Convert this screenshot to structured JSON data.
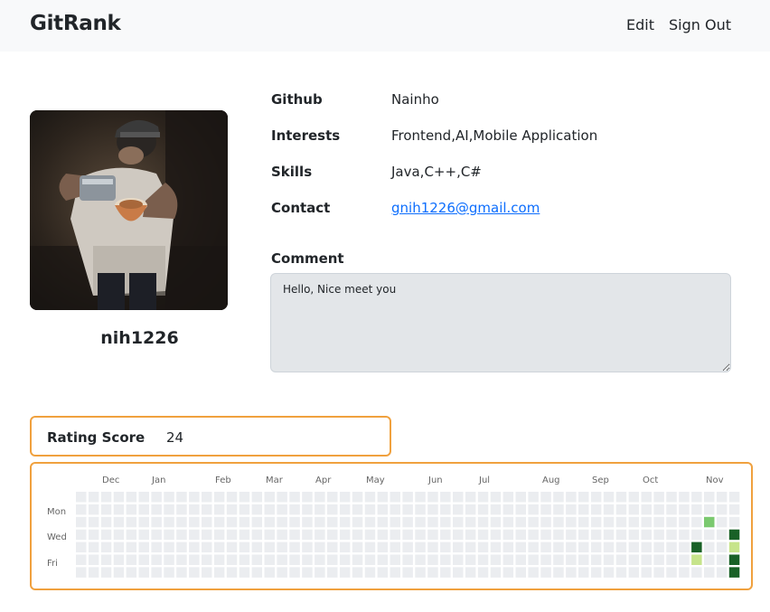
{
  "navbar": {
    "brand": "GitRank",
    "edit_label": "Edit",
    "signout_label": "Sign Out"
  },
  "profile": {
    "username": "nih1226",
    "rows": [
      {
        "label": "Github",
        "value": "Nainho"
      },
      {
        "label": "Interests",
        "value": "Frontend,AI,Mobile Application"
      },
      {
        "label": "Skills",
        "value": "Java,C++,C#"
      },
      {
        "label": "Contact",
        "value": "gnih1226@gmail.com"
      }
    ],
    "comment_label": "Comment",
    "comment_text": "Hello, Nice meet you"
  },
  "rating": {
    "label": "Rating Score",
    "value": "24"
  },
  "contributions": {
    "months": [
      "Dec",
      "Jan",
      "Feb",
      "Mar",
      "Apr",
      "May",
      "Jun",
      "Jul",
      "Aug",
      "Sep",
      "Oct",
      "Nov"
    ],
    "day_labels": [
      "Mon",
      "Wed",
      "Fri"
    ],
    "colors": {
      "empty": "#ebedf0",
      "level1": "#c6e48b",
      "level2": "#7bc96f",
      "level3": "#239a3b",
      "level4": "#196127"
    },
    "active_cells": [
      {
        "week": 50,
        "day": 2,
        "level": 2
      },
      {
        "week": 49,
        "day": 4,
        "level": 4
      },
      {
        "week": 49,
        "day": 5,
        "level": 1
      },
      {
        "week": 52,
        "day": 3,
        "level": 4
      },
      {
        "week": 52,
        "day": 4,
        "level": 1
      },
      {
        "week": 52,
        "day": 5,
        "level": 4
      },
      {
        "week": 52,
        "day": 6,
        "level": 4
      }
    ]
  }
}
